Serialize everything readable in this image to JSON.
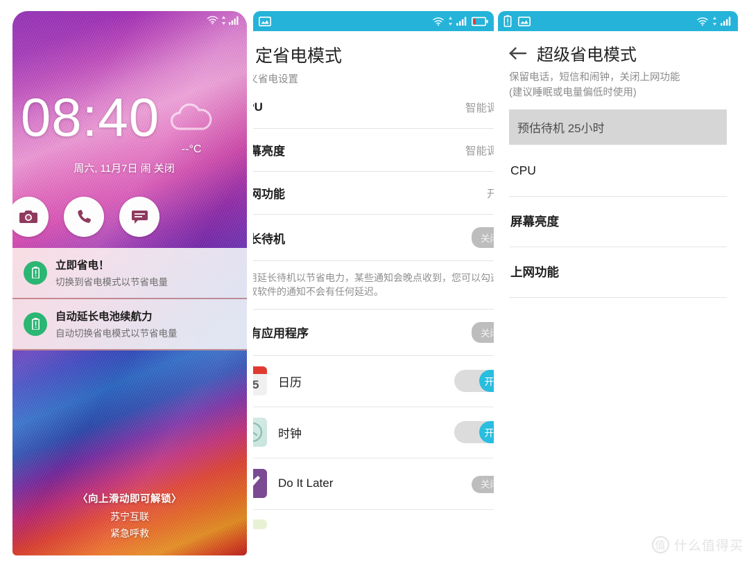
{
  "panel1": {
    "name": "lockscreen",
    "status": {
      "wifi_icon": "wifi-icon",
      "signal_icon": "signal-icon"
    },
    "clock": {
      "time": "08:40",
      "weather_icon": "cloud-icon",
      "temperature": "--°C"
    },
    "date_line": "周六, 11月7日  闹 关闭",
    "shortcuts": [
      {
        "name": "camera-shortcut",
        "icon": "camera-icon"
      },
      {
        "name": "phone-shortcut",
        "icon": "phone-icon"
      },
      {
        "name": "message-shortcut",
        "icon": "message-icon"
      }
    ],
    "notifications": [
      {
        "icon": "battery-alert-icon",
        "title": "立即省电！",
        "subtitle": "切换到省电模式以节省电量"
      },
      {
        "icon": "battery-alert-icon",
        "title": "自动延长电池续航力",
        "subtitle": "自动切换省电模式以节省电量"
      }
    ],
    "unlock_hint": "〈向上滑动即可解锁〉",
    "line2": "苏宁互联",
    "line3": "紧急呼救"
  },
  "panel2": {
    "name": "custom-power-saving-mode",
    "status": {
      "left_icons": [
        "screenshot-icon"
      ],
      "right_icons": [
        "wifi-icon",
        "signal-icon",
        "battery-low-icon"
      ]
    },
    "title": "自定省电模式",
    "subtitle": "定义省电设置",
    "rows": [
      {
        "label": "CPU",
        "value": "智能调节",
        "type": "value"
      },
      {
        "label": "屏幕亮度",
        "value": "智能调节",
        "type": "value"
      },
      {
        "label": "上网功能",
        "value": "开启",
        "type": "value"
      },
      {
        "label": "延长待机",
        "value": "关闭",
        "type": "pill"
      }
    ],
    "note": "启用延长待机以节省电力，某些通知会晚点收到，您可以勾选取取软件的通知不会有任何延迟。",
    "apps_row": {
      "label": "所有应用程序",
      "value": "关闭",
      "type": "pill"
    },
    "apps": [
      {
        "name": "日历",
        "icon": "calendar-icon",
        "toggle": "开启",
        "state": "on"
      },
      {
        "name": "时钟",
        "icon": "clock-icon",
        "toggle": "开启",
        "state": "on"
      },
      {
        "name": "Do It Later",
        "icon": "doitlater-icon",
        "toggle": "关闭",
        "state": "off"
      }
    ]
  },
  "panel3": {
    "name": "super-power-saving-mode",
    "status": {
      "left_icons": [
        "battery-alert-icon",
        "screenshot-icon"
      ],
      "right_icons": [
        "wifi-icon",
        "signal-icon"
      ]
    },
    "back_icon": "arrow-left-icon",
    "title": "超级省电模式",
    "description": "保留电话，短信和闹钟，关闭上网功能\n(建议睡眠或电量偏低时使用)",
    "estimate": "预估待机 25小时",
    "rows": [
      {
        "label": "CPU",
        "value": "",
        "bold": false
      },
      {
        "label": "屏幕亮度",
        "value": "",
        "bold": true
      },
      {
        "label": "上网功能",
        "value": "",
        "bold": true
      }
    ]
  },
  "watermark": {
    "logo": "值",
    "text": "什么值得买"
  }
}
